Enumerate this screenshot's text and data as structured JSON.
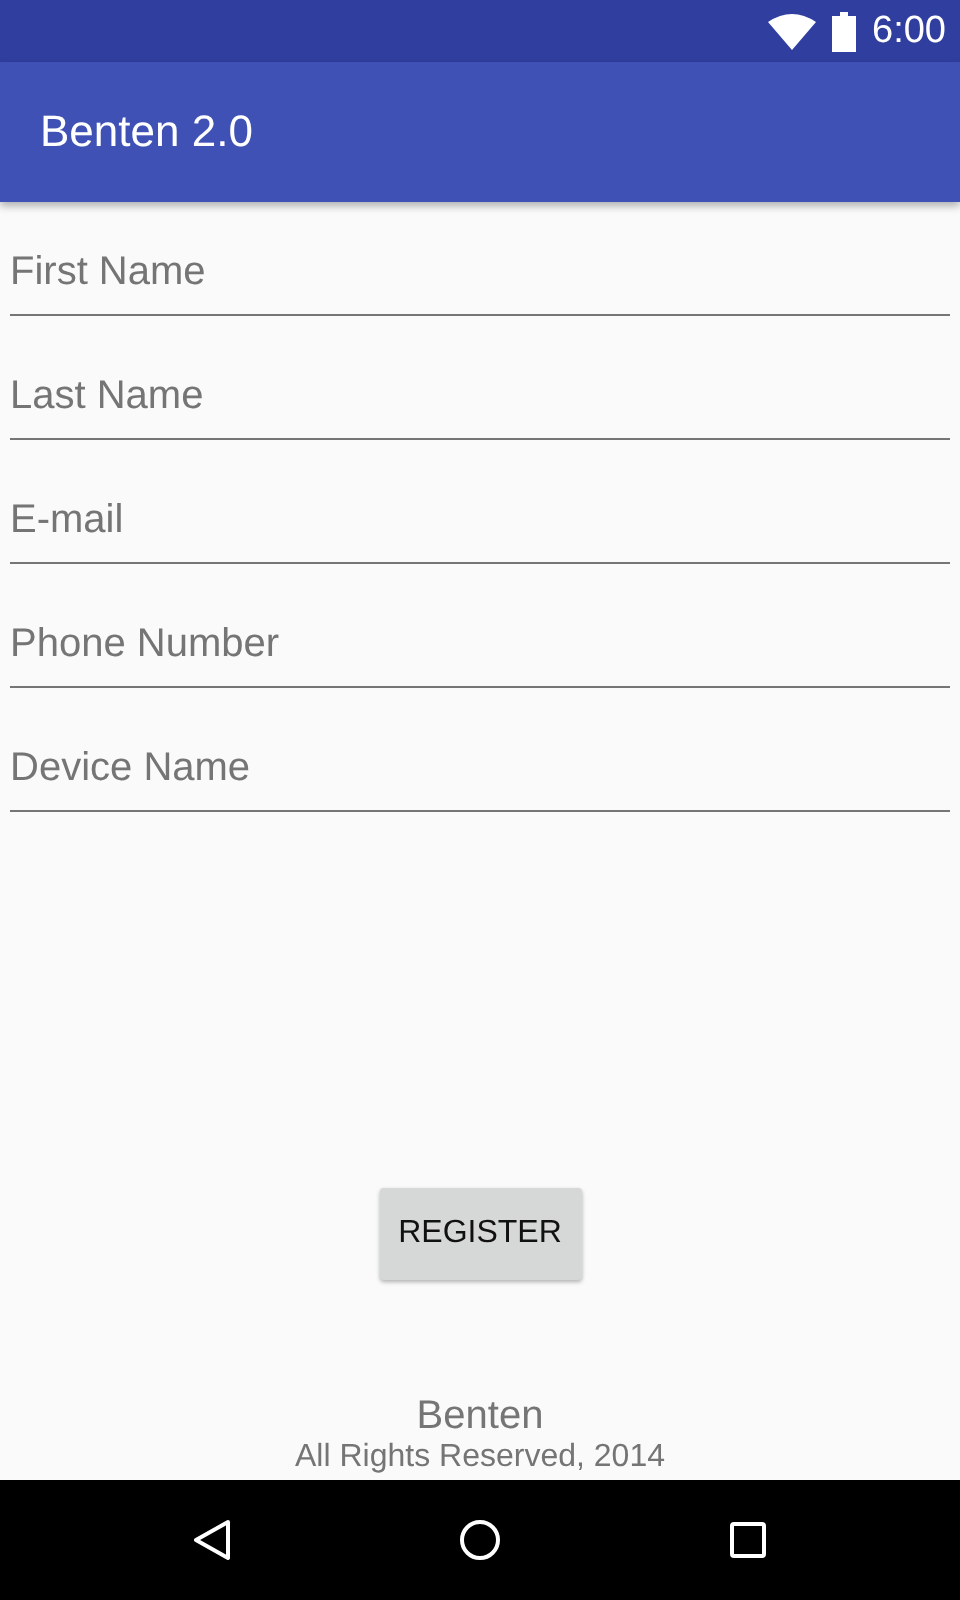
{
  "status_bar": {
    "time": "6:00"
  },
  "app_bar": {
    "title": "Benten 2.0"
  },
  "fields": [
    {
      "placeholder": "First Name"
    },
    {
      "placeholder": "Last Name"
    },
    {
      "placeholder": "E-mail"
    },
    {
      "placeholder": "Phone Number"
    },
    {
      "placeholder": "Device Name"
    }
  ],
  "button": {
    "label": "REGISTER"
  },
  "footer": {
    "name": "Benten",
    "copyright": "All Rights Reserved, 2014"
  }
}
